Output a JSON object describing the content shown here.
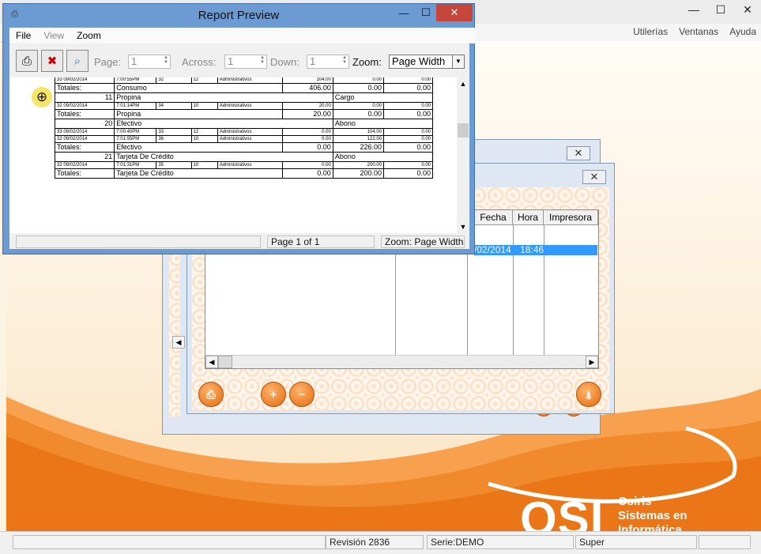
{
  "app": {
    "menu": [
      "Utilerías",
      "Ventanas",
      "Ayuda"
    ],
    "window_controls": {
      "minimize": "—",
      "maximize": "☐",
      "close": "✕"
    },
    "logo": {
      "big": "OSI",
      "line1": "Osiris",
      "line2": "Sistemas en",
      "line3": "Informática"
    },
    "status": {
      "cell1": "",
      "cell2": "Revisión 2836",
      "cell3": "Serie:DEMO",
      "cell4": "Super",
      "cell5": ""
    }
  },
  "child_window": {
    "close_label": "✕",
    "grid_headers": [
      "Fecha",
      "Hora",
      "Impresora"
    ],
    "selected_row": {
      "fecha": "/02/2014",
      "hora": "18:46"
    },
    "scroll_left": "◀",
    "scroll_right": "▶",
    "scroll_left_small": "◀",
    "buttons": {
      "print": "⎙",
      "zoom_in": "+",
      "zoom_out": "−",
      "exit": "⍋"
    }
  },
  "report_preview": {
    "title": "Report Preview",
    "icon": "printer-icon",
    "controls": {
      "minimize": "—",
      "maximize": "☐",
      "close": "✕"
    },
    "menu": [
      "File",
      "View",
      "Zoom"
    ],
    "toolbar": {
      "print_icon": "🖶",
      "close_icon": "✖",
      "find_icon": "🔍",
      "page_label": "Page:",
      "page_value": "1",
      "across_label": "Across:",
      "across_value": "1",
      "down_label": "Down:",
      "down_value": "1",
      "zoom_label": "Zoom:",
      "zoom_value": "Page Width"
    },
    "report_rows": [
      {
        "type": "small",
        "cells": [
          "33 09/02/2014",
          "7:00:55PM",
          "32",
          "12",
          "Administrativos",
          "104.00",
          "0.00",
          "0.00"
        ]
      },
      {
        "type": "total",
        "cells": [
          "Totales:",
          "Consumo",
          "406.00",
          "0.00",
          "0.00"
        ]
      },
      {
        "type": "group",
        "cells": [
          "11",
          "Propina",
          "Cargo"
        ]
      },
      {
        "type": "small",
        "cells": [
          "32 09/02/2014",
          "7:01:14PM",
          "34",
          "10",
          "Administrativos",
          "20.00",
          "0.00",
          "0.00"
        ]
      },
      {
        "type": "total",
        "cells": [
          "Totales:",
          "Propina",
          "20.00",
          "0.00",
          "0.00"
        ]
      },
      {
        "type": "group",
        "cells": [
          "20",
          "Efectivo",
          "Abono"
        ]
      },
      {
        "type": "small",
        "cells": [
          "33 09/02/2014",
          "7:00:40PM",
          "33",
          "12",
          "Administrativos",
          "0.00",
          "104.00",
          "0.00"
        ]
      },
      {
        "type": "small",
        "cells": [
          "32 09/02/2014",
          "7:01:55PM",
          "36",
          "10",
          "Administrativos",
          "0.00",
          "122.00",
          "0.00"
        ]
      },
      {
        "type": "total",
        "cells": [
          "Totales:",
          "Efectivo",
          "0.00",
          "226.00",
          "0.00"
        ]
      },
      {
        "type": "group",
        "cells": [
          "21",
          "Tarjeta De Crédito",
          "Abono"
        ]
      },
      {
        "type": "small",
        "cells": [
          "32 09/02/2014",
          "7:01:31PM",
          "35",
          "10",
          "Administrativos",
          "0.00",
          "200.00",
          "0.00"
        ]
      },
      {
        "type": "total",
        "cells": [
          "Totales:",
          "Tarjeta De Crédito",
          "0.00",
          "200.00",
          "0.00"
        ]
      }
    ],
    "status": {
      "left": "",
      "page": "Page 1 of 1",
      "zoom": "Zoom: Page Width"
    }
  }
}
